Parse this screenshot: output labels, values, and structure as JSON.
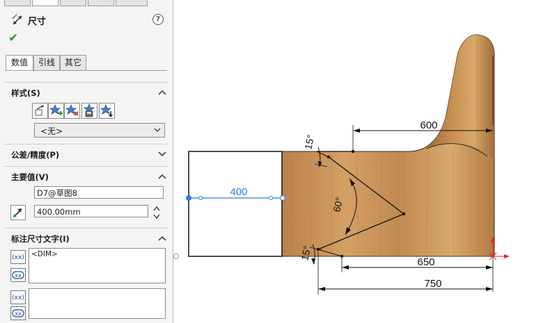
{
  "header": {
    "title": "尺寸",
    "help": "?"
  },
  "tabs": [
    {
      "label": "数值"
    },
    {
      "label": "引线"
    },
    {
      "label": "其它"
    }
  ],
  "sections": {
    "style": {
      "title": "样式(S)",
      "select_value": "<无>"
    },
    "tolerance": {
      "title": "公差/精度(P)"
    },
    "primary": {
      "title": "主要值(V)",
      "name_value": "D7@草图8",
      "value": "400.00mm"
    },
    "dimtext": {
      "title": "标注尺寸文字(I)",
      "text": "<DIM>"
    }
  },
  "icons": {
    "header": "dimension-icon",
    "ok": "checkmark-icon",
    "style_buttons": [
      "apply-default-icon",
      "add-style-icon",
      "delete-style-icon",
      "save-style-icon",
      "load-style-icon"
    ]
  },
  "drawing": {
    "dims": {
      "d400": "400",
      "d600": "600",
      "d650": "650",
      "d750": "750",
      "a15_top": "15°",
      "a60": "60°",
      "a15_bottom": "15°"
    },
    "colors": {
      "wood": "#c8955a",
      "selected": "#2e7ee0",
      "origin": "#e02020"
    }
  }
}
